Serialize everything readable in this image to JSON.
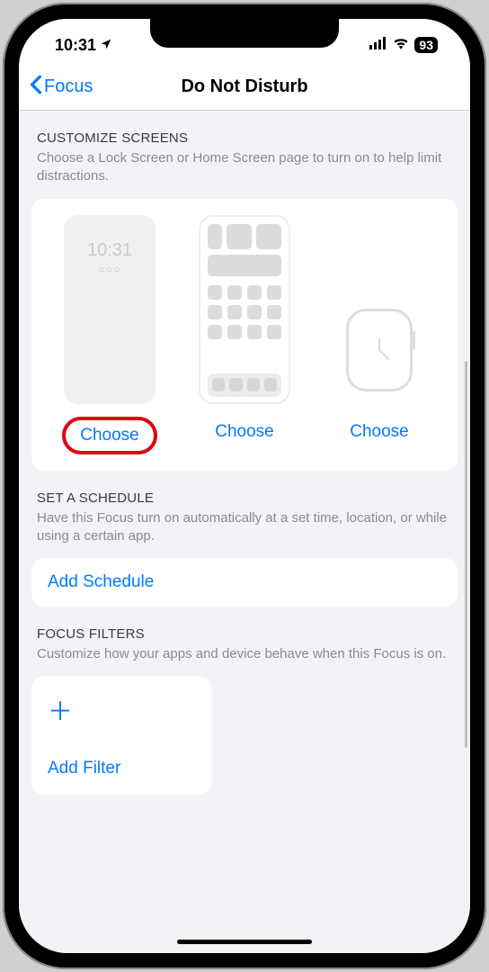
{
  "status": {
    "time": "10:31",
    "battery": "93"
  },
  "nav": {
    "back": "Focus",
    "title": "Do Not Disturb"
  },
  "customize": {
    "title": "CUSTOMIZE SCREENS",
    "desc": "Choose a Lock Screen or Home Screen page to turn on to help limit distractions.",
    "lock_time": "10:31",
    "choose_lock": "Choose",
    "choose_home": "Choose",
    "choose_watch": "Choose"
  },
  "schedule": {
    "title": "SET A SCHEDULE",
    "desc": "Have this Focus turn on automatically at a set time, location, or while using a certain app.",
    "add": "Add Schedule"
  },
  "filters": {
    "title": "FOCUS FILTERS",
    "desc": "Customize how your apps and device behave when this Focus is on.",
    "add": "Add Filter"
  }
}
